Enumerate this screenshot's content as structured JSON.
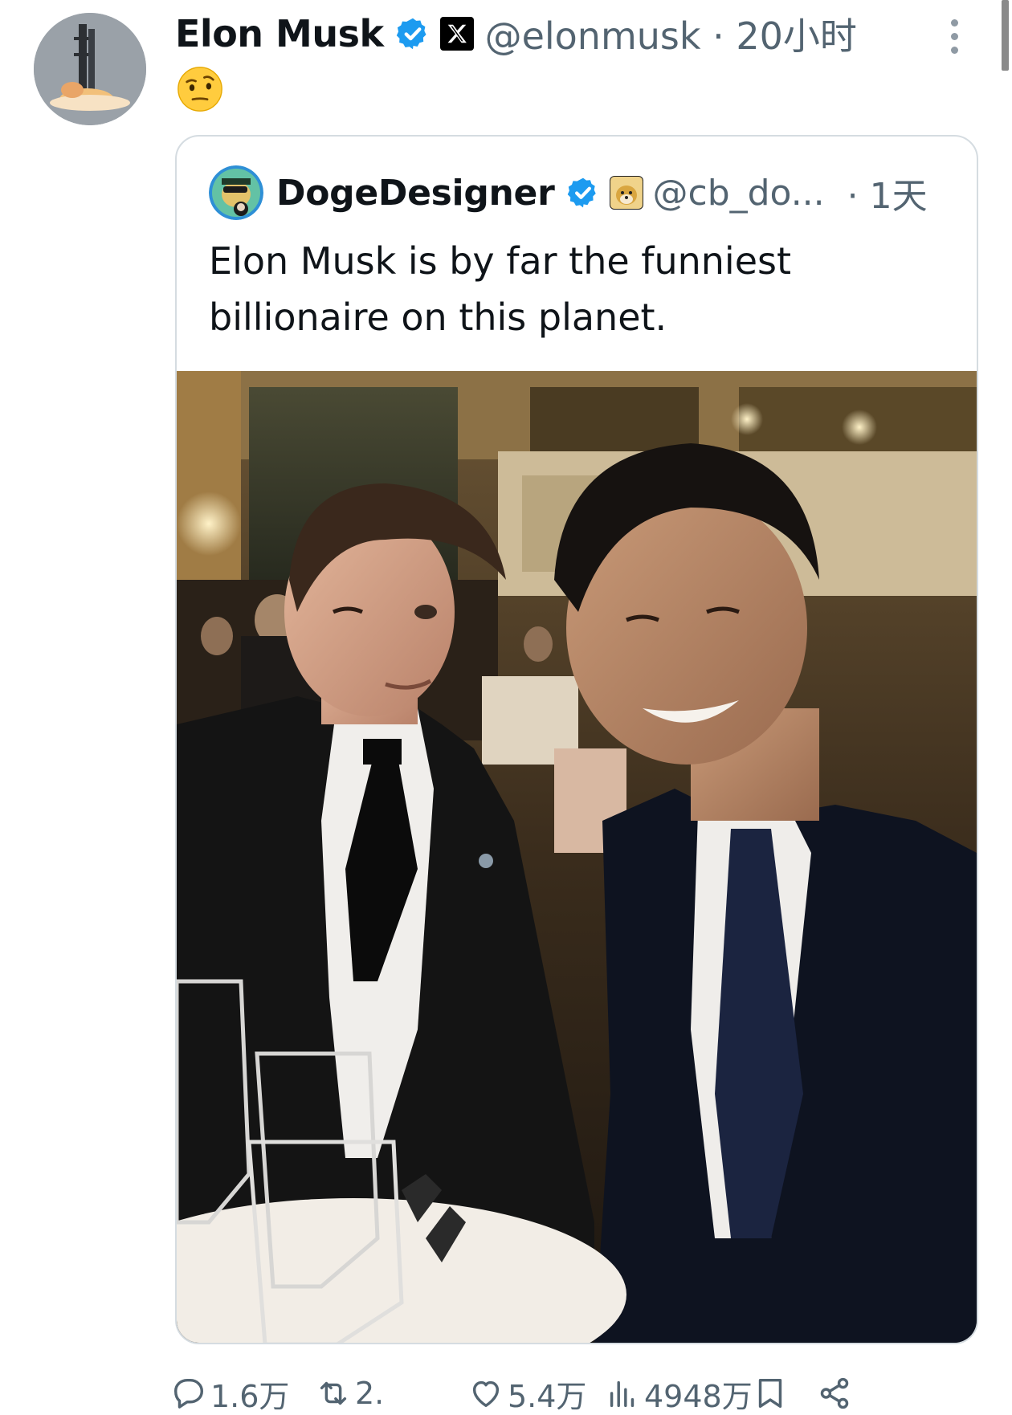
{
  "post": {
    "author_name": "Elon Musk",
    "handle_time": "@elonmusk · 20小时",
    "emoji": "🤨",
    "avatar_icon": "rocket-launch-avatar-icon",
    "verified_color": "#1d9bf0"
  },
  "quoted": {
    "author_name": "DogeDesigner",
    "handle": "@cb_do...",
    "time": "· 1天",
    "text": "Elon Musk is by far the funniest billionaire on this planet.",
    "photo_icon": "selfie-photo"
  },
  "actions": {
    "reply_count": "1.6万",
    "repost_count": "2.",
    "like_count": "5.4万",
    "views_count": "4948万"
  }
}
